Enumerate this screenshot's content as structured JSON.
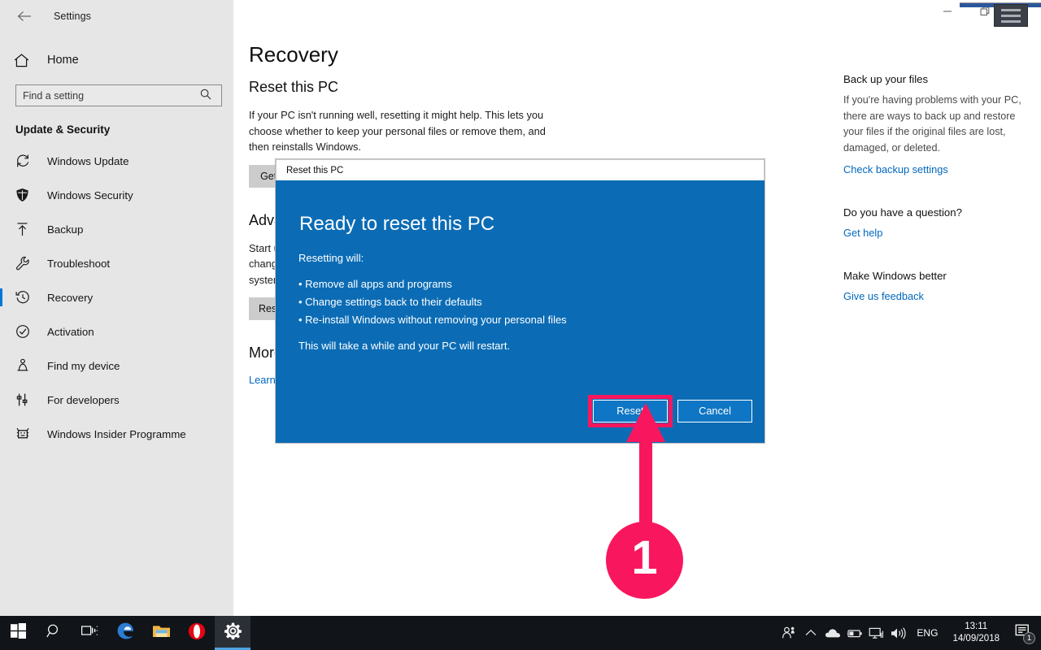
{
  "window": {
    "app_title": "Settings",
    "back_icon": "back-arrow-icon",
    "controls": {
      "minimize": "minimize-icon",
      "maximize": "maximize-icon",
      "close": "close-icon"
    }
  },
  "sidebar": {
    "home_label": "Home",
    "home_icon": "home-icon",
    "search": {
      "placeholder": "Find a setting",
      "value": "",
      "icon": "search-icon"
    },
    "group_header": "Update & Security",
    "items": [
      {
        "label": "Windows Update",
        "icon": "refresh-icon",
        "selected": false
      },
      {
        "label": "Windows Security",
        "icon": "shield-icon",
        "selected": false
      },
      {
        "label": "Backup",
        "icon": "upload-arrow-icon",
        "selected": false
      },
      {
        "label": "Troubleshoot",
        "icon": "wrench-icon",
        "selected": false
      },
      {
        "label": "Recovery",
        "icon": "history-clock-icon",
        "selected": true
      },
      {
        "label": "Activation",
        "icon": "check-circle-icon",
        "selected": false
      },
      {
        "label": "Find my device",
        "icon": "person-pin-icon",
        "selected": false
      },
      {
        "label": "For developers",
        "icon": "tools-icon",
        "selected": false
      },
      {
        "label": "Windows Insider Programme",
        "icon": "insider-bug-icon",
        "selected": false
      }
    ]
  },
  "main": {
    "page_title": "Recovery",
    "sections": [
      {
        "heading": "Reset this PC",
        "body": "If your PC isn't running well, resetting it might help. This lets you choose whether to keep your personal files or remove them, and then reinstalls Windows.",
        "button": "Get started"
      },
      {
        "heading": "Advanced startup",
        "body": "Start up from a device or disc (such as a USB drive or DVD), change Windows startup settings, or restore Windows from a system image. This will restart your PC.",
        "button": "Restart now"
      },
      {
        "heading": "More recovery options",
        "link": "Learn how to start fresh with a clean installation of Windows"
      }
    ]
  },
  "right_rail": [
    {
      "heading": "Back up your files",
      "body": "If you're having problems with your PC, there are ways to back up and restore your files if the original files are lost, damaged, or deleted.",
      "link": "Check backup settings"
    },
    {
      "heading": "Do you have a question?",
      "body": "",
      "link": "Get help"
    },
    {
      "heading": "Make Windows better",
      "body": "",
      "link": "Give us feedback"
    }
  ],
  "overlay": {
    "menu_icon": "hamburger-menu-icon"
  },
  "dialog": {
    "titlebar": "Reset this PC",
    "heading": "Ready to reset this PC",
    "intro": "Resetting will:",
    "bullets": [
      "• Remove all apps and programs",
      "• Change settings back to their defaults",
      "• Re-install Windows without removing your personal files"
    ],
    "footnote": "This will take a while and your PC will restart.",
    "primary_button": "Reset",
    "secondary_button": "Cancel",
    "background_color": "#0b6cb5",
    "highlight_color": "#f8175e"
  },
  "annotation": {
    "step_number": "1",
    "color": "#f8175e"
  },
  "taskbar": {
    "left_items": [
      {
        "name": "start-button",
        "icon": "windows-logo-icon",
        "active": false
      },
      {
        "name": "search-button",
        "icon": "search-icon",
        "active": false
      },
      {
        "name": "task-view-button",
        "icon": "task-view-icon",
        "active": false
      },
      {
        "name": "edge-button",
        "icon": "edge-icon",
        "active": false
      },
      {
        "name": "file-explorer-button",
        "icon": "folder-icon",
        "active": false
      },
      {
        "name": "opera-button",
        "icon": "opera-icon",
        "active": false
      },
      {
        "name": "settings-button",
        "icon": "gear-icon",
        "active": true
      }
    ],
    "tray": {
      "people_icon": "people-icon",
      "chevron_icon": "chevron-up-icon",
      "onedrive_icon": "cloud-icon",
      "battery_icon": "battery-icon",
      "network_icon": "monitor-network-icon",
      "volume_icon": "speaker-icon",
      "language": "ENG",
      "time": "13:11",
      "date": "14/09/2018",
      "notification_icon": "notification-icon",
      "notification_count": "1"
    }
  }
}
